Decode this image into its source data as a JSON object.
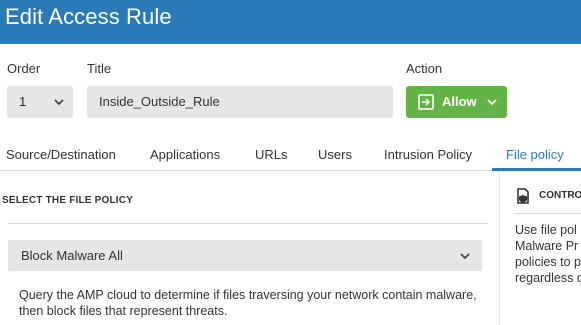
{
  "window": {
    "title": "Edit Access Rule"
  },
  "form": {
    "order_label": "Order",
    "order_value": "1",
    "title_label": "Title",
    "title_value": "Inside_Outside_Rule",
    "action_label": "Action",
    "action_value": "Allow"
  },
  "tabs": [
    {
      "label": "Source/Destination",
      "active": false
    },
    {
      "label": "Applications",
      "active": false
    },
    {
      "label": "URLs",
      "active": false
    },
    {
      "label": "Users",
      "active": false
    },
    {
      "label": "Intrusion Policy",
      "active": false
    },
    {
      "label": "File policy",
      "active": true
    }
  ],
  "file_policy": {
    "section_heading": "SELECT THE FILE POLICY",
    "selected_policy": "Block Malware All",
    "description": "Query the AMP cloud to determine if files traversing your network contain malware, then block files that represent threats."
  },
  "side_panel": {
    "heading": "CONTRO",
    "text_lines": [
      "Use file pol",
      "Malware Pr",
      "policies to p",
      "regardless o"
    ]
  },
  "colors": {
    "header_bg": "#2a7ab7",
    "accent": "#2a7ab7",
    "allow_button": "#63b346",
    "field_bg": "#e6e6e6"
  },
  "icons": {
    "order_chevron": "chevron-down-icon",
    "allow_icon": "allow-arrow-icon",
    "allow_chevron": "chevron-down-icon",
    "policy_chevron": "chevron-down-icon",
    "side_icon": "file-shield-icon"
  }
}
